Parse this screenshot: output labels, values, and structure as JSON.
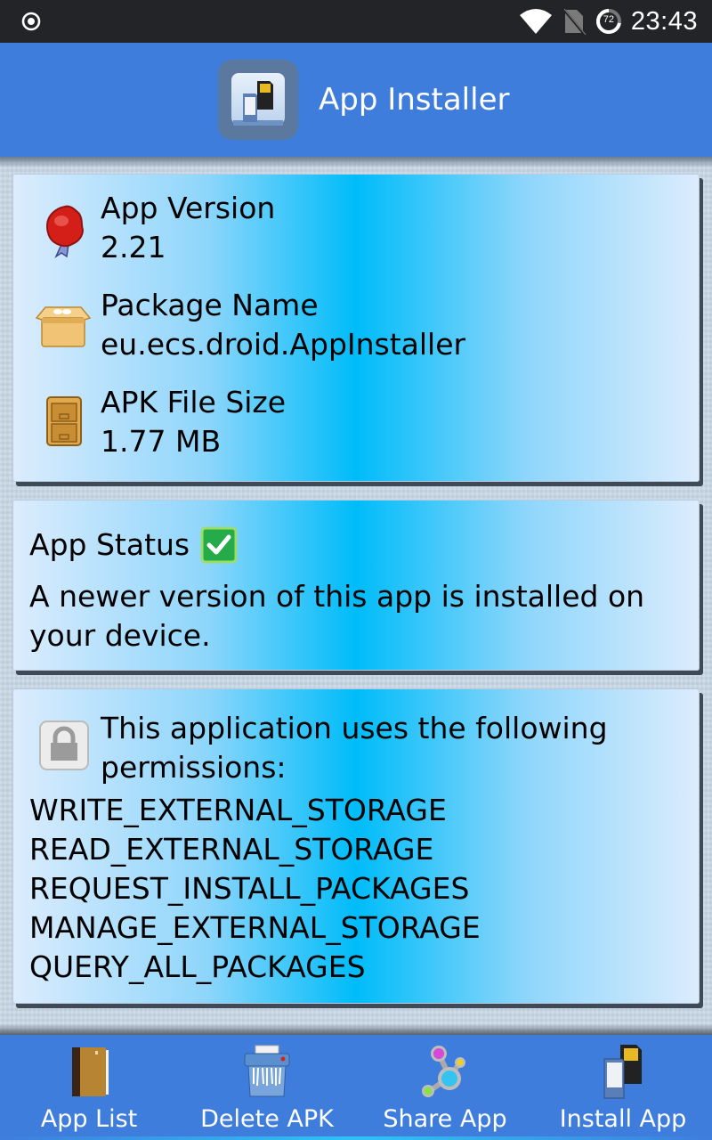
{
  "status_bar": {
    "left_icon": "location-target-icon",
    "icons": [
      "wifi-icon",
      "no-sim-icon",
      "battery-ring-icon"
    ],
    "battery_level": "72",
    "time": "23:43"
  },
  "header": {
    "icon": "app-installer-sd-card-icon",
    "title": "App Installer"
  },
  "info_card": {
    "rows": [
      {
        "icon": "wax-seal-ribbon-icon",
        "label": "App Version",
        "value": "2.21"
      },
      {
        "icon": "open-box-icon",
        "label": "Package Name",
        "value": "eu.ecs.droid.AppInstaller"
      },
      {
        "icon": "file-cabinet-icon",
        "label": "APK File Size",
        "value": "1.77 MB"
      }
    ]
  },
  "status_card": {
    "title": "App Status",
    "status_icon": "green-checkbox-icon",
    "message": "A newer version of this app is installed on your device."
  },
  "permissions_card": {
    "icon": "padlock-icon",
    "intro": "This application uses the following permissions:",
    "permissions": [
      "WRITE_EXTERNAL_STORAGE",
      "READ_EXTERNAL_STORAGE",
      "REQUEST_INSTALL_PACKAGES",
      "MANAGE_EXTERNAL_STORAGE",
      "QUERY_ALL_PACKAGES"
    ]
  },
  "bottom_nav": {
    "items": [
      {
        "icon": "address-book-icon",
        "label": "App List"
      },
      {
        "icon": "shredder-icon",
        "label": "Delete APK"
      },
      {
        "icon": "share-nodes-icon",
        "label": "Share App"
      },
      {
        "icon": "sd-card-install-icon",
        "label": "Install App"
      }
    ]
  },
  "colors": {
    "accent": "#3f7ddc",
    "status_bar": "#232427",
    "card_center": "#00bcf9"
  }
}
